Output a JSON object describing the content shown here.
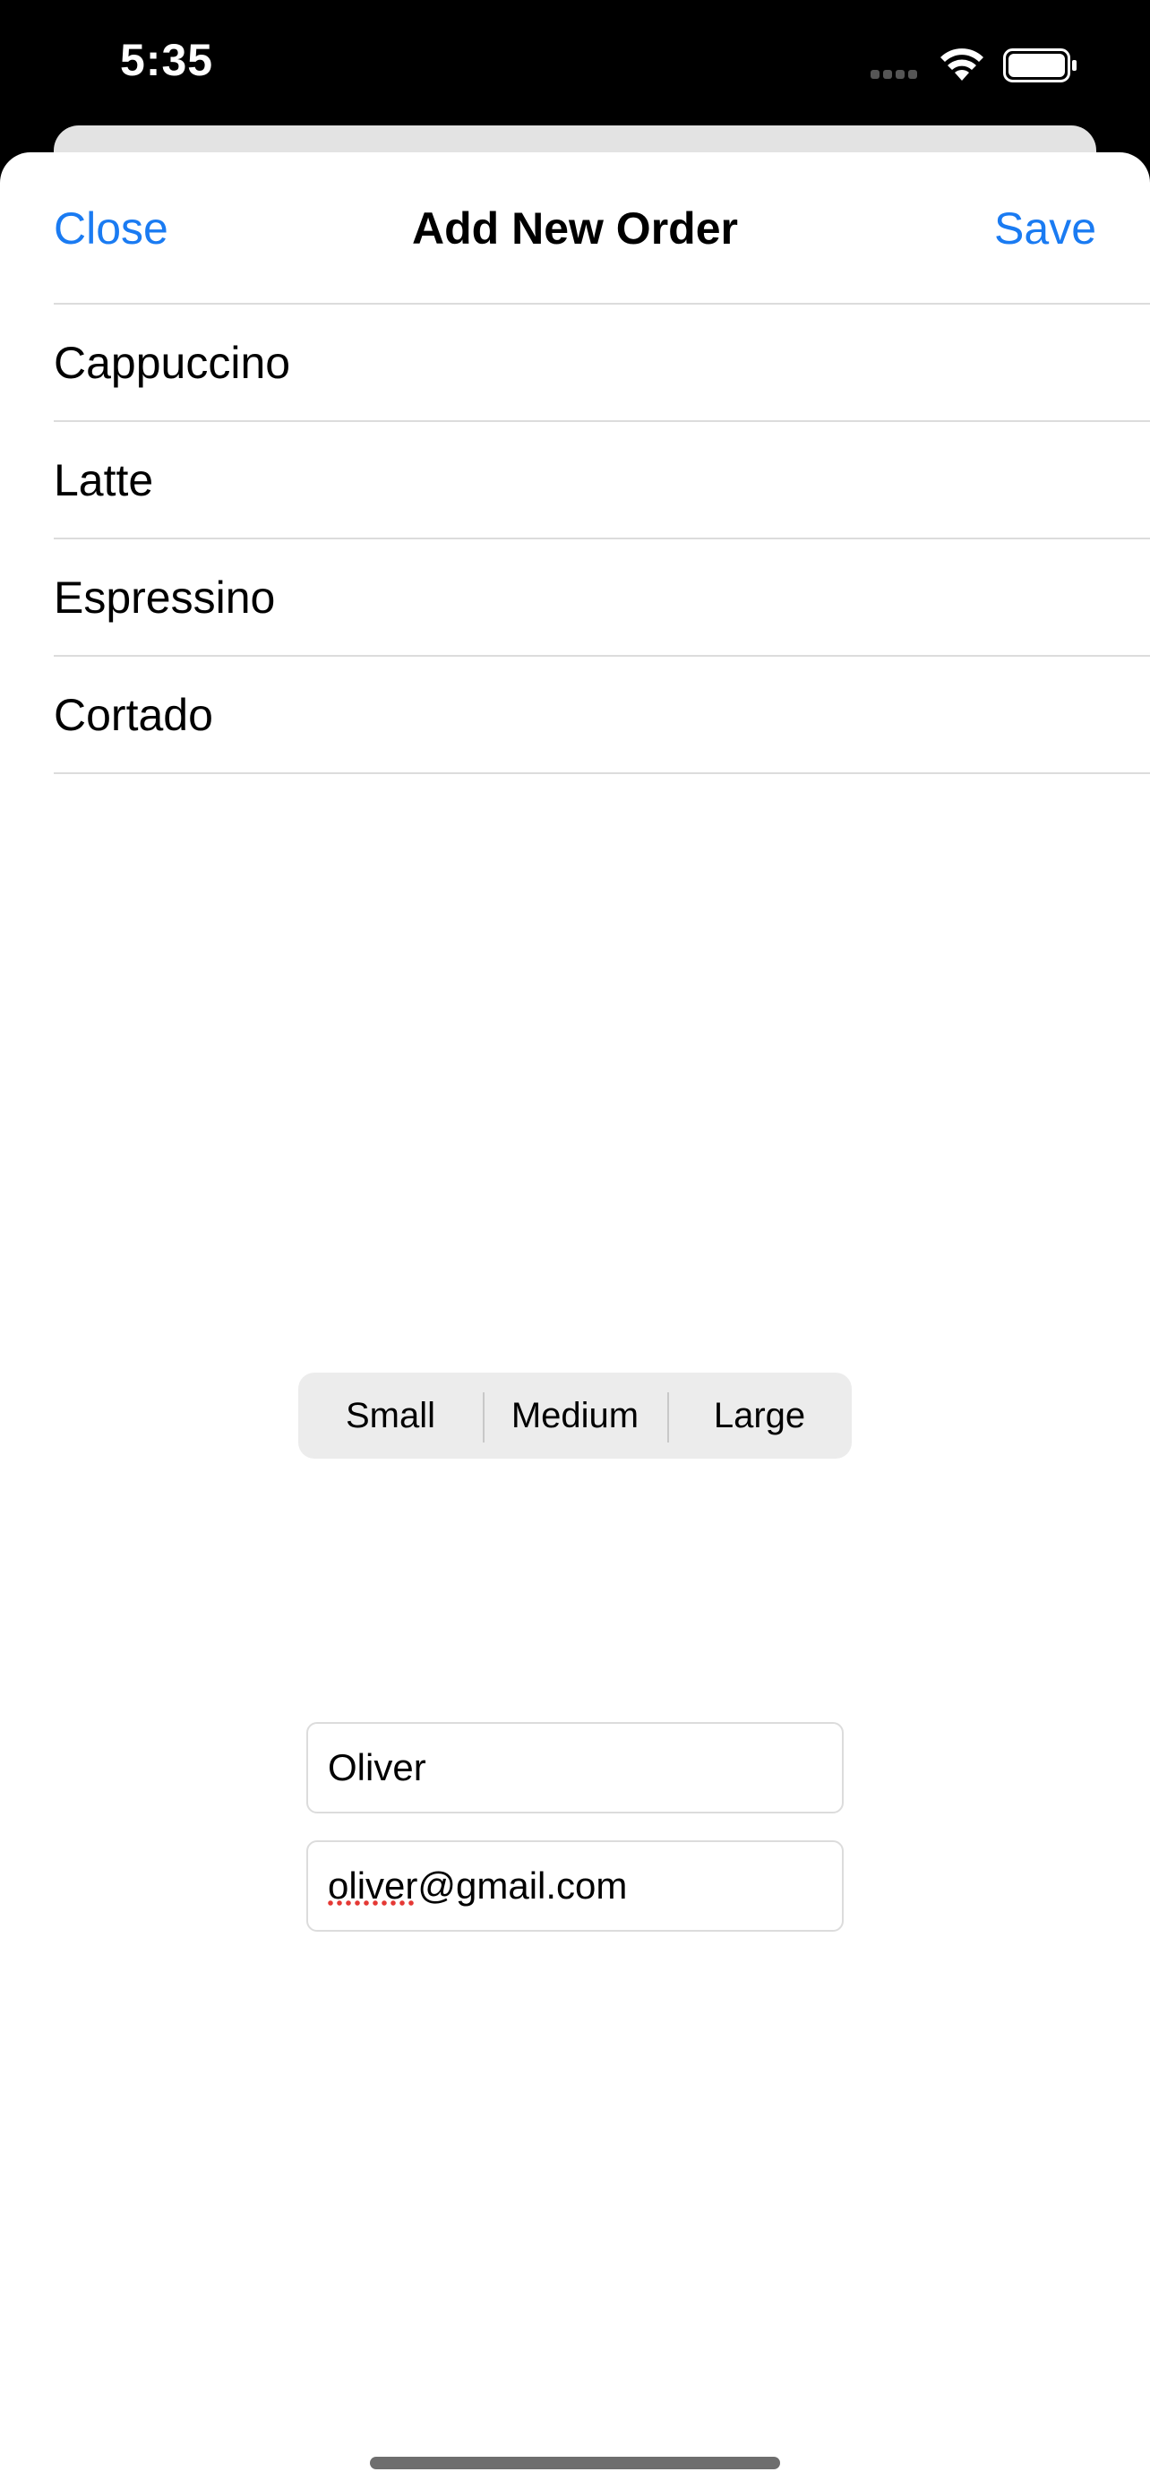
{
  "status_bar": {
    "time": "5:35"
  },
  "nav": {
    "close_label": "Close",
    "title": "Add New Order",
    "save_label": "Save"
  },
  "coffee_list": {
    "items": [
      {
        "label": "Cappuccino"
      },
      {
        "label": "Latte"
      },
      {
        "label": "Espressino"
      },
      {
        "label": "Cortado"
      }
    ]
  },
  "size_picker": {
    "options": [
      {
        "label": "Small"
      },
      {
        "label": "Medium"
      },
      {
        "label": "Large"
      }
    ]
  },
  "form": {
    "name_value": "Oliver",
    "email_value": "oliver@gmail.com"
  },
  "colors": {
    "accent": "#1a7bf2",
    "separator": "#dcdcdc",
    "segment_bg": "#ececec"
  }
}
